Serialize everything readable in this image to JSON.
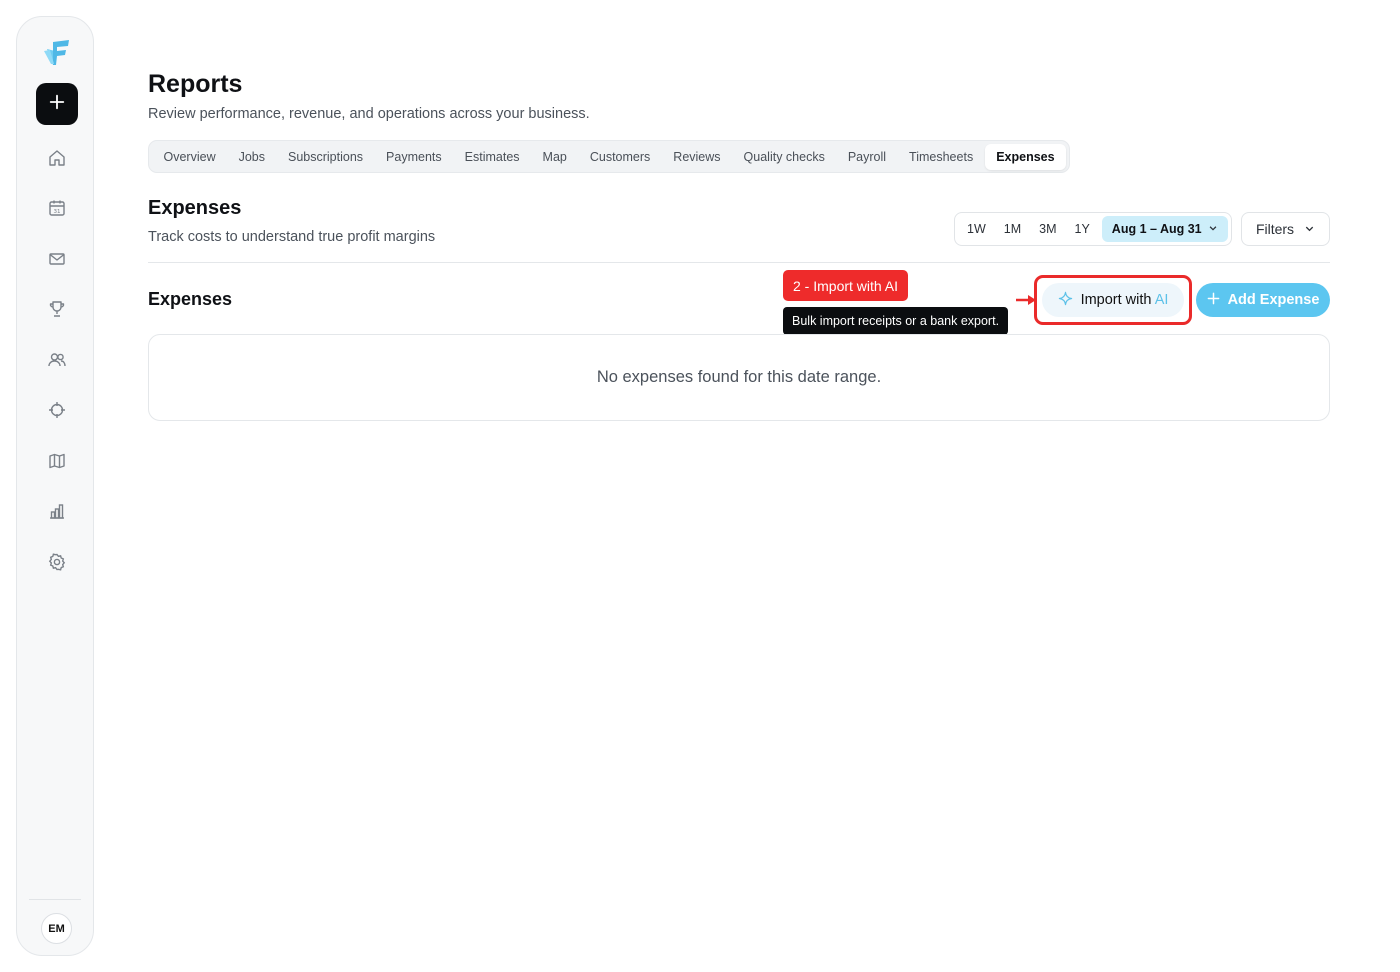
{
  "sidebar": {
    "logo": "app-logo",
    "add_icon": "plus-icon",
    "nav_icons": [
      "home-icon",
      "calendar-icon",
      "mail-icon",
      "trophy-icon",
      "users-icon",
      "crosshair-icon",
      "map-icon",
      "bar-chart-icon",
      "gear-icon"
    ],
    "calendar_day": "31",
    "avatar_initials": "EM"
  },
  "header": {
    "title": "Reports",
    "subtitle": "Review performance, revenue, and operations across your business."
  },
  "tabs": {
    "items": [
      {
        "label": "Overview"
      },
      {
        "label": "Jobs"
      },
      {
        "label": "Subscriptions"
      },
      {
        "label": "Payments"
      },
      {
        "label": "Estimates"
      },
      {
        "label": "Map"
      },
      {
        "label": "Customers"
      },
      {
        "label": "Reviews"
      },
      {
        "label": "Quality checks"
      },
      {
        "label": "Payroll"
      },
      {
        "label": "Timesheets"
      },
      {
        "label": "Expenses"
      }
    ],
    "active": "Expenses"
  },
  "section": {
    "title": "Expenses",
    "subtitle": "Track costs to understand true profit margins"
  },
  "range": {
    "options": [
      "1W",
      "1M",
      "3M",
      "1Y"
    ],
    "date_label": "Aug 1 – Aug 31"
  },
  "filters_label": "Filters",
  "list": {
    "title": "Expenses",
    "empty_text": "No expenses found for this date range."
  },
  "annotation": {
    "step_label": "2 - Import with AI",
    "tooltip": "Bulk import receipts or a bank export.",
    "highlight_color": "#ea2a2a"
  },
  "actions": {
    "import_label": "Import with",
    "import_ai": "AI",
    "import_icon": "sparkle-icon",
    "add_label": "Add Expense",
    "add_icon": "plus-icon",
    "accent_color": "#5cc6f0"
  }
}
